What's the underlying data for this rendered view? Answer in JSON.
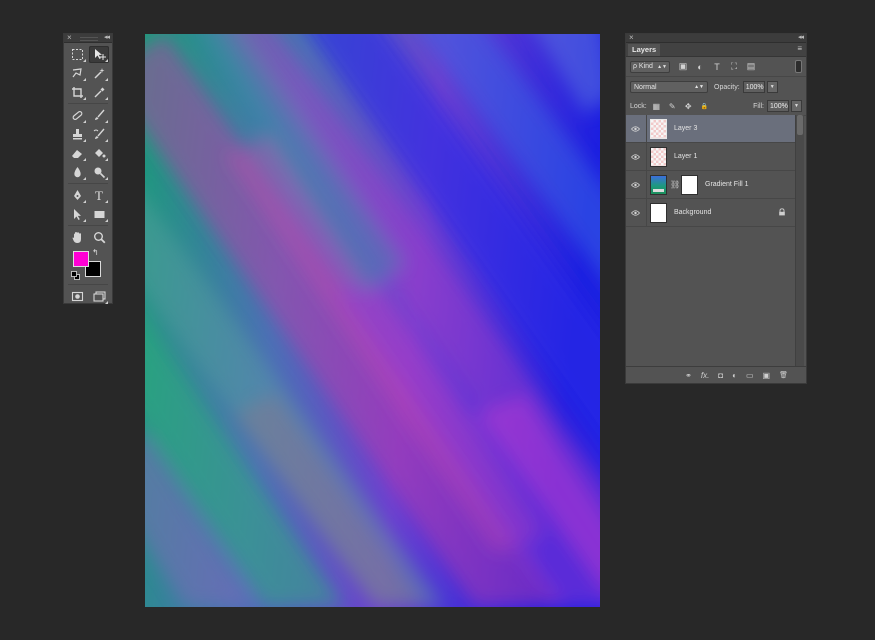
{
  "tools_panel": {
    "close_glyph": "×",
    "collapse_glyph": "◂◂",
    "tools": [
      [
        "marquee-icon",
        "move-icon"
      ],
      [
        "lasso-icon",
        "magic-wand-icon"
      ],
      [
        "crop-icon",
        "eyedropper-icon"
      ],
      [
        "healing-brush-icon",
        "brush-icon"
      ],
      [
        "clone-stamp-icon",
        "history-brush-icon"
      ],
      [
        "eraser-icon",
        "paint-bucket-icon"
      ],
      [
        "blur-icon",
        "dodge-icon"
      ],
      [
        "pen-icon",
        "type-icon"
      ],
      [
        "path-select-icon",
        "rectangle-icon"
      ],
      [
        "hand-icon",
        "zoom-icon"
      ]
    ],
    "active_tool": "move-icon",
    "type_tool_glyph": "T",
    "foreground_color": "#ff00d4",
    "background_color": "#000000",
    "swap_glyph": "↰"
  },
  "canvas": {
    "base_color": "#5a3fc4"
  },
  "layers_panel": {
    "close_glyph": "×",
    "collapse_glyph": "◂◂",
    "tab_label": "Layers",
    "menu_glyph": "≡",
    "filter_kind": "ρ Kind",
    "filter_icons": [
      "▣",
      "◐",
      "T",
      "⛶",
      "▤"
    ],
    "blend_mode": "Normal",
    "opacity_label": "Opacity:",
    "opacity_value": "100%",
    "lock_label": "Lock:",
    "lock_icons": [
      "▦",
      "✎",
      "✥",
      "🔒"
    ],
    "fill_label": "Fill:",
    "fill_value": "100%",
    "layers": [
      {
        "name": "Layer 3",
        "thumb": "checker",
        "selected": true
      },
      {
        "name": "Layer 1",
        "thumb": "checker",
        "selected": false
      },
      {
        "name": "Gradient Fill 1",
        "thumb": "gradient",
        "selected": false
      },
      {
        "name": "Background",
        "thumb": "white",
        "selected": false
      }
    ],
    "footer_icons": [
      "⚭",
      "fx.",
      "◘",
      "◐",
      "▭",
      "▣",
      "🗑"
    ]
  }
}
